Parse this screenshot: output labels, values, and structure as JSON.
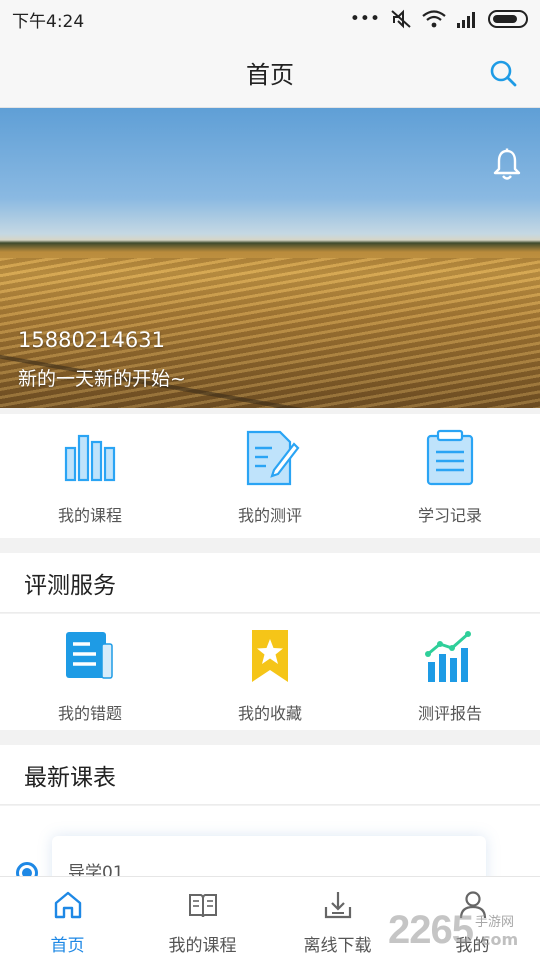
{
  "status_bar": {
    "time": "下午4:24",
    "dots": "•••"
  },
  "header": {
    "title": "首页",
    "search_icon": "search-icon"
  },
  "banner": {
    "phone": "15880214631",
    "slogan": "新的一天新的开始~",
    "bell_icon": "bell-icon"
  },
  "quick_menu": [
    {
      "label": "我的课程",
      "icon": "bar-chart-icon"
    },
    {
      "label": "我的测评",
      "icon": "document-edit-icon"
    },
    {
      "label": "学习记录",
      "icon": "clipboard-icon"
    }
  ],
  "eval_section": {
    "title": "评测服务",
    "items": [
      {
        "label": "我的错题",
        "icon": "error-book-icon"
      },
      {
        "label": "我的收藏",
        "icon": "star-bookmark-icon"
      },
      {
        "label": "测评报告",
        "icon": "report-chart-icon"
      }
    ]
  },
  "schedule_section": {
    "title": "最新课表",
    "card_title": "导学01"
  },
  "bottom_nav": [
    {
      "label": "首页",
      "icon": "home-icon",
      "active": true
    },
    {
      "label": "我的课程",
      "icon": "book-icon",
      "active": false
    },
    {
      "label": "离线下载",
      "icon": "download-icon",
      "active": false
    },
    {
      "label": "我的",
      "icon": "user-icon",
      "active": false
    }
  ],
  "watermark": {
    "number": "2265",
    "cn": "手游网",
    "com": ".com"
  },
  "colors": {
    "accent": "#1e88e5",
    "icon_blue": "#2aa4f4",
    "star_yellow": "#f5c518"
  }
}
